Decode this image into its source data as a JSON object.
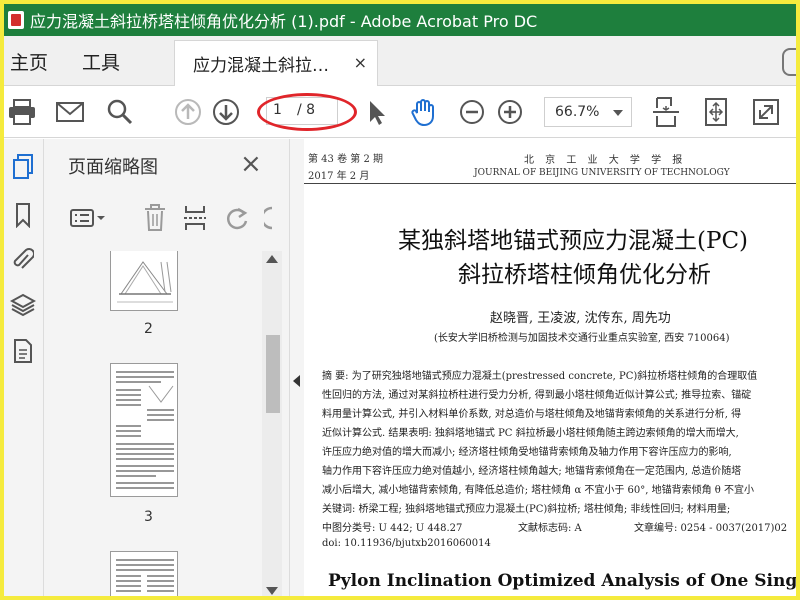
{
  "window": {
    "title": "应力混凝土斜拉桥塔柱倾角优化分析 (1).pdf - Adobe Acrobat Pro DC"
  },
  "menu_tabs": {
    "home": "主页",
    "tools": "工具",
    "doc_tab": "应力混凝土斜拉桥...",
    "doc_tab_close": "×"
  },
  "toolbar": {
    "current_page": "1",
    "total_pages": "/ 8",
    "zoom": "66.7%"
  },
  "panel": {
    "title": "页面缩略图",
    "close": "×",
    "thumbs": [
      {
        "label": "2"
      },
      {
        "label": "3"
      }
    ]
  },
  "document": {
    "header_left_1": "第 43 卷  第 2 期",
    "header_left_2": "2017 年  2 月",
    "header_center": "北 京 工 业 大 学 学 报",
    "header_en": "JOURNAL OF BEIJING UNIVERSITY OF TECHNOLOGY",
    "title_line1": "某独斜塔地锚式预应力混凝土(PC)",
    "title_line2": "斜拉桥塔柱倾角优化分析",
    "authors": "赵晓晋, 王凌波, 沈传东, 周先功",
    "affiliation": "(长安大学旧桥检测与加固技术交通行业重点实验室, 西安   710064)",
    "abstract_lines": [
      "摘    要: 为了研究独塔地锚式预应力混凝土(prestressed concrete, PC)斜拉桥塔柱倾角的合理取值",
      "性回归的方法, 通过对某斜拉桥柱进行受力分析, 得到最小塔柱倾角近似计算公式; 推导拉索、锚碇",
      "料用量计算公式, 并引入材料单价系数, 对总造价与塔柱倾角及地锚背索倾角的关系进行分析, 得",
      "近似计算公式. 结果表明: 独斜塔地锚式 PC 斜拉桥最小塔柱倾角随主跨边索倾角的增大而增大,",
      "许压应力绝对值的增大而减小; 经济塔柱倾角受地锚背索倾角及轴力作用下容许压应力的影响,",
      "轴力作用下容许压应力绝对值越小, 经济塔柱倾角越大; 地锚背索倾角在一定范围内, 总造价随塔",
      "减小后增大, 减小地锚背索倾角, 有降低总造价; 塔柱倾角 α 不宜小于 60°, 地锚背索倾角 θ 不宜小"
    ],
    "keywords": "关键词: 桥梁工程; 独斜塔地锚式预应力混凝土(PC)斜拉桥; 塔柱倾角; 非线性回归; 材料用量;",
    "classification": "中图分类号: U 442; U 448.27",
    "doc_code": "文献标志码: A",
    "article_no": "文章编号: 0254 - 0037(2017)02",
    "doi": "doi: 10.11936/bjutxb2016060014",
    "english_title": "Pylon Inclination Optimized Analysis of One Single Inclin"
  },
  "colors": {
    "titlebar": "#1e7f3d",
    "frame": "#f5eb3d",
    "hand_tool": "#1f6fd1",
    "annotation": "#e0252a",
    "rail_active": "#1f6fd1"
  },
  "icons": {
    "toolbar": [
      "print-icon",
      "email-icon",
      "search-icon",
      "prev-page-icon",
      "next-page-icon",
      "select-arrow-icon",
      "hand-icon",
      "zoom-out-icon",
      "zoom-in-icon",
      "fit-page-icon",
      "fit-width-icon",
      "fullscreen-icon"
    ],
    "rail": [
      "page-thumbnails-icon",
      "bookmark-icon",
      "attachment-icon",
      "layers-icon",
      "document-properties-icon"
    ],
    "panel": [
      "options-menu-icon",
      "delete-icon",
      "insert-page-icon",
      "rotate-icon"
    ]
  }
}
